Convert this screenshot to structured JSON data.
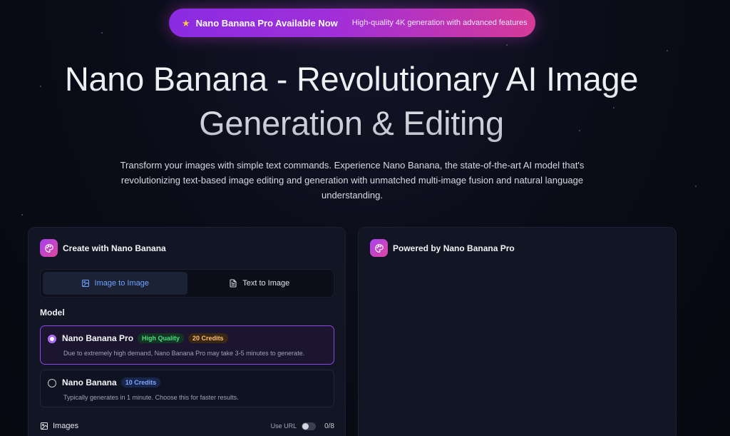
{
  "announcement": {
    "primary": "Nano Banana Pro Available Now",
    "secondary": "High-quality 4K generation with advanced features",
    "icon": "star-icon"
  },
  "hero": {
    "title": "Nano Banana - Revolutionary AI Image Generation & Editing",
    "subtitle": "Transform your images with simple text commands. Experience Nano Banana, the state-of-the-art AI model that's revolutionizing text-based image editing and generation with unmatched multi-image fusion and natural language understanding."
  },
  "create_card": {
    "title": "Create with Nano Banana",
    "tabs": [
      {
        "label": "Image to Image",
        "active": true,
        "icon": "image-icon"
      },
      {
        "label": "Text to Image",
        "active": false,
        "icon": "document-icon"
      }
    ],
    "model_label": "Model",
    "models": [
      {
        "name": "Nano Banana Pro",
        "badges": [
          "High Quality",
          "20 Credits"
        ],
        "description": "Due to extremely high demand, Nano Banana Pro may take 3-5 minutes to generate.",
        "selected": true
      },
      {
        "name": "Nano Banana",
        "badges": [
          "10 Credits"
        ],
        "description": "Typically generates in 1 minute. Choose this for faster results.",
        "selected": false
      }
    ],
    "images": {
      "label": "Images",
      "use_url_label": "Use URL",
      "use_url_enabled": false,
      "count": "0/8"
    }
  },
  "preview_card": {
    "title": "Powered by Nano Banana Pro"
  },
  "colors": {
    "background": "#080a15",
    "accent_purple": "#8a2be2",
    "accent_pink": "#d63a98",
    "active_tab_text": "#6fa3ff"
  }
}
